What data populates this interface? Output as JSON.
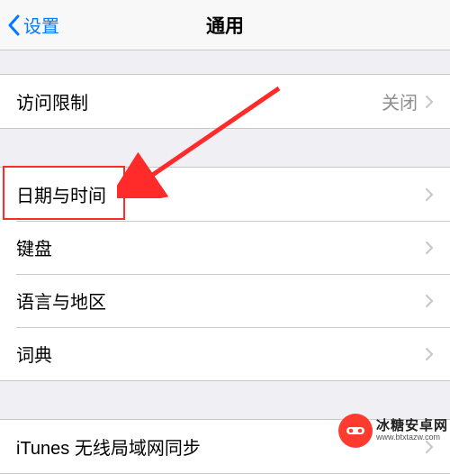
{
  "navbar": {
    "back_label": "设置",
    "title": "通用"
  },
  "row_restrictions": {
    "label": "访问限制",
    "value": "关闭"
  },
  "row_datetime": {
    "label": "日期与时间"
  },
  "row_keyboard": {
    "label": "键盘"
  },
  "row_language": {
    "label": "语言与地区"
  },
  "row_dictionary": {
    "label": "词典"
  },
  "row_itunes": {
    "label": "iTunes 无线局域网同步"
  },
  "watermark": {
    "cn": "冰糖安卓网",
    "en": "www.btxtazw.com"
  },
  "colors": {
    "accent": "#007aff",
    "annotation": "#ff2a2a"
  }
}
